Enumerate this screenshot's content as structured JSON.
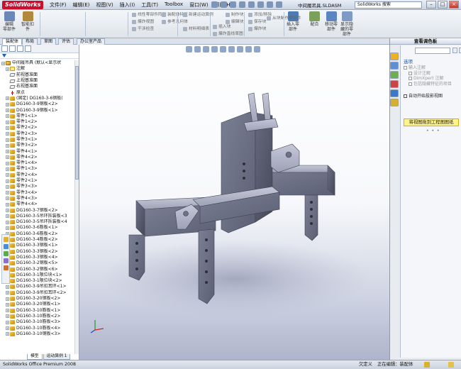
{
  "app": {
    "logo": "SolidWorks",
    "menus": [
      "文件(F)",
      "编辑(E)",
      "视图(V)",
      "插入(I)",
      "工具(T)",
      "Toolbox",
      "窗口(W)",
      "帮助(H)"
    ],
    "document_title": "中间履吊具.SLDASM",
    "search_placeholder": "SolidWorks 搜索",
    "window_controls": [
      "–",
      "□",
      "×"
    ]
  },
  "ribbon": {
    "buttons": [
      {
        "label": "编辑\n零部件",
        "icon": "edit-component-icon",
        "color": "#6a87b8"
      },
      {
        "label": "智能扣\n件",
        "icon": "smart-fastener-icon",
        "color": "#b08a3a"
      },
      {
        "label": "插入零\n部件",
        "icon": "insert-component-icon",
        "color": "#4c7bb5"
      },
      {
        "label": "配合",
        "icon": "mate-icon",
        "color": "#7aa05a"
      },
      {
        "label": "移动零\n部件",
        "icon": "move-component-icon",
        "color": "#5b84c0"
      },
      {
        "label": "显示隐\n藏的零\n部件",
        "icon": "show-hidden-icon",
        "color": "#7d9bc4"
      }
    ],
    "small_items": [
      {
        "label": "线性零部件阵列",
        "icon": "linear-pattern-icon"
      },
      {
        "label": "爆炸视图",
        "icon": "exploded-view-icon"
      },
      {
        "label": "干涉检查",
        "icon": "interference-check-icon"
      },
      {
        "label": "装配体特征",
        "icon": "assembly-feature-icon"
      },
      {
        "label": "参考几何体",
        "icon": "reference-geometry-icon"
      },
      {
        "label": "新建运动算例",
        "icon": "motion-study-icon"
      },
      {
        "label": "材料明细表",
        "icon": "bom-icon"
      },
      {
        "label": "爆炸直线草图",
        "icon": "explode-line-icon"
      },
      {
        "label": "插入块",
        "icon": "insert-block-icon"
      },
      {
        "label": "制作块",
        "icon": "make-block-icon"
      },
      {
        "label": "编辑块",
        "icon": "edit-block-icon"
      },
      {
        "label": "保存块",
        "icon": "save-block-icon"
      },
      {
        "label": "添加/移除",
        "icon": "add-remove-icon"
      },
      {
        "label": "爆炸块",
        "icon": "explode-block-icon"
      },
      {
        "label": "从块制作零部件",
        "icon": "block-to-part-icon"
      }
    ]
  },
  "tabs": {
    "items": [
      "装配体",
      "布局",
      "草图",
      "评估",
      "办公室产品"
    ],
    "active": 0
  },
  "feature_tree": {
    "items": [
      {
        "label": "中间履吊具  (默认<显示状",
        "type": "assy",
        "expandable": true,
        "level": 0
      },
      {
        "label": "注解",
        "type": "note",
        "expandable": true,
        "level": 1
      },
      {
        "label": "前视基准面",
        "type": "plane",
        "expandable": false,
        "level": 1
      },
      {
        "label": "上视基准面",
        "type": "plane",
        "expandable": false,
        "level": 1
      },
      {
        "label": "右视基准面",
        "type": "plane",
        "expandable": false,
        "level": 1
      },
      {
        "label": "原点",
        "type": "origin",
        "expandable": false,
        "level": 1
      },
      {
        "label": "(固定) DG160-3-6钢板(",
        "type": "part",
        "expandable": true,
        "level": 1
      },
      {
        "label": "DG160-3-9钢板<2>",
        "type": "part",
        "expandable": true,
        "level": 1
      },
      {
        "label": "DG160-3-9钢板<1>",
        "type": "part",
        "expandable": true,
        "level": 1
      },
      {
        "label": "零件1<1>",
        "type": "part",
        "expandable": true,
        "level": 1
      },
      {
        "label": "零件1<2>",
        "type": "part",
        "expandable": true,
        "level": 1
      },
      {
        "label": "零件2<2>",
        "type": "part",
        "expandable": true,
        "level": 1
      },
      {
        "label": "零件2<3>",
        "type": "part",
        "expandable": true,
        "level": 1
      },
      {
        "label": "零件3<1>",
        "type": "part",
        "expandable": true,
        "level": 1
      },
      {
        "label": "零件3<2>",
        "type": "part",
        "expandable": true,
        "level": 1
      },
      {
        "label": "零件4<1>",
        "type": "part",
        "expandable": true,
        "level": 1
      },
      {
        "label": "零件4<2>",
        "type": "part",
        "expandable": true,
        "level": 1
      },
      {
        "label": "零件1<4>",
        "type": "part",
        "expandable": true,
        "level": 1
      },
      {
        "label": "零件1<3>",
        "type": "part",
        "expandable": true,
        "level": 1
      },
      {
        "label": "零件2<4>",
        "type": "part",
        "expandable": true,
        "level": 1
      },
      {
        "label": "零件2<1>",
        "type": "part",
        "expandable": true,
        "level": 1
      },
      {
        "label": "零件3<3>",
        "type": "part",
        "expandable": true,
        "level": 1
      },
      {
        "label": "零件3<4>",
        "type": "part",
        "expandable": true,
        "level": 1
      },
      {
        "label": "零件4<3>",
        "type": "part",
        "expandable": true,
        "level": 1
      },
      {
        "label": "零件4<4>",
        "type": "part",
        "expandable": true,
        "level": 1
      },
      {
        "label": "DG160-3-7钢板<2>",
        "type": "part",
        "expandable": true,
        "level": 1
      },
      {
        "label": "DG160-3-5吊环拆装板<3",
        "type": "part",
        "expandable": true,
        "level": 1
      },
      {
        "label": "DG160-3-5吊环拆装板<4",
        "type": "part",
        "expandable": true,
        "level": 1
      },
      {
        "label": "DG160-3-6筋板<1>",
        "type": "part",
        "expandable": true,
        "level": 1
      },
      {
        "label": "DG160-3-6筋板<2>",
        "type": "part",
        "expandable": true,
        "level": 1
      },
      {
        "label": "DG160-3-4筋板<2>",
        "type": "part",
        "expandable": true,
        "level": 1
      },
      {
        "label": "DG160-3-3钢板<1>",
        "type": "part",
        "expandable": true,
        "level": 1
      },
      {
        "label": "DG160-3-3钢板<2>",
        "type": "part",
        "expandable": true,
        "level": 1
      },
      {
        "label": "DG160-3-3钢板<4>",
        "type": "part",
        "expandable": true,
        "level": 1
      },
      {
        "label": "DG160-3-2钢板<5>",
        "type": "part",
        "expandable": true,
        "level": 1
      },
      {
        "label": "DG160-3-2钢板<6>",
        "type": "part",
        "expandable": true,
        "level": 1
      },
      {
        "label": "DG160-3-1限位块<1>",
        "type": "part",
        "expandable": true,
        "level": 1
      },
      {
        "label": "DG160-3-1限位块<2>",
        "type": "part",
        "expandable": true,
        "level": 1
      },
      {
        "label": "DG160-3-9吊扣耳环<1>",
        "type": "part",
        "expandable": true,
        "level": 1
      },
      {
        "label": "DG160-3-9吊扣耳环<2>",
        "type": "part",
        "expandable": true,
        "level": 1
      },
      {
        "label": "DG160-3-20钢板<2>",
        "type": "part",
        "expandable": true,
        "level": 1
      },
      {
        "label": "DG160-3-20钢板<1>",
        "type": "part",
        "expandable": true,
        "level": 1
      },
      {
        "label": "DG160-3-10筋板<1>",
        "type": "part",
        "expandable": true,
        "level": 1
      },
      {
        "label": "DG160-3-10筋板<2>",
        "type": "part",
        "expandable": true,
        "level": 1
      },
      {
        "label": "DG160-3-10筋板<3>",
        "type": "part",
        "expandable": true,
        "level": 1
      },
      {
        "label": "DG160-3-10筋板<4>",
        "type": "part",
        "expandable": true,
        "level": 1
      },
      {
        "label": "DG160-3-10钢板<3>",
        "type": "part",
        "expandable": true,
        "level": 1
      }
    ],
    "bottom_tabs": [
      "模型",
      "运动算例 1"
    ]
  },
  "task_pane": {
    "title": "查看调色板",
    "section_title": "选项",
    "options": [
      {
        "label": "输入注解",
        "enabled": false,
        "indent": false
      },
      {
        "label": "设计注解",
        "enabled": false,
        "indent": true
      },
      {
        "label": "DimXpert 注解",
        "enabled": false,
        "indent": true
      },
      {
        "label": "包括隐藏特征的项目",
        "enabled": false,
        "indent": true
      },
      {
        "label": "自动开始投影视图",
        "enabled": true,
        "indent": false
      }
    ],
    "action_button": "将视图拖到工程图图纸",
    "tab_colors": [
      "#f0b020",
      "#5f8fd0",
      "#6bb04a",
      "#c44",
      "#3a78c9",
      "#d8b030"
    ]
  },
  "status": {
    "app_name": "SolidWorks Office Premium 2008",
    "state": "欠定义",
    "editing": "正在编辑：装配体"
  },
  "model": {
    "steel_color": "#8e92a6",
    "dark_color": "#5a5e70",
    "light_color": "#b7bbcc"
  }
}
